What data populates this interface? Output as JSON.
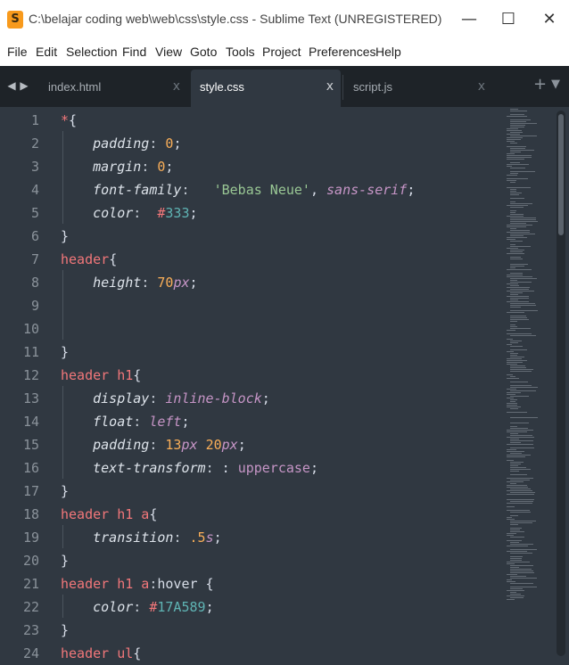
{
  "window": {
    "title": "C:\\belajar coding web\\web\\css\\style.css - Sublime Text (UNREGISTERED)",
    "minimize": "—",
    "maximize": "☐",
    "close": "✕"
  },
  "menu": [
    "File",
    "Edit",
    "Selection",
    "Find",
    "View",
    "Goto",
    "Tools",
    "Project",
    "Preferences",
    "Help"
  ],
  "tabs": [
    {
      "label": "index.html",
      "active": false
    },
    {
      "label": "style.css",
      "active": true
    },
    {
      "label": "script.js",
      "active": false
    }
  ],
  "tab_close": "x",
  "tabbar_tools": {
    "add": "+",
    "dropdown": "▼"
  },
  "nav": {
    "back": "◀",
    "forward": "▶"
  },
  "editor": {
    "language": "CSS",
    "line_numbers": [
      "1",
      "2",
      "3",
      "4",
      "5",
      "6",
      "7",
      "8",
      "9",
      "10",
      "11",
      "12",
      "13",
      "14",
      "15",
      "16",
      "17",
      "18",
      "19",
      "20",
      "21",
      "22",
      "23",
      "24"
    ],
    "lines": [
      "*{",
      "    padding: 0;",
      "    margin: 0;",
      "    font-family:   'Bebas Neue', sans-serif;",
      "    color:  #333;",
      "}",
      "header{",
      "    height: 70px;",
      "",
      "",
      "}",
      "header h1{",
      "    display: inline-block;",
      "    float: left;",
      "    padding: 13px 20px;",
      "    text-transform: : uppercase;",
      "}",
      "header h1 a{",
      "    transition: .5s;",
      "}",
      "header h1 a:hover {",
      "    color: #17A589;",
      "}",
      "header ul{"
    ]
  },
  "colors": {
    "editor_bg": "#303841",
    "tabbar_bg": "#1e2328",
    "selector": "#f2777a",
    "number": "#f9ae58",
    "string": "#99c794",
    "keyword_value": "#c695c6",
    "color_value": "#5fb4b4",
    "line_number": "#8a929a"
  }
}
